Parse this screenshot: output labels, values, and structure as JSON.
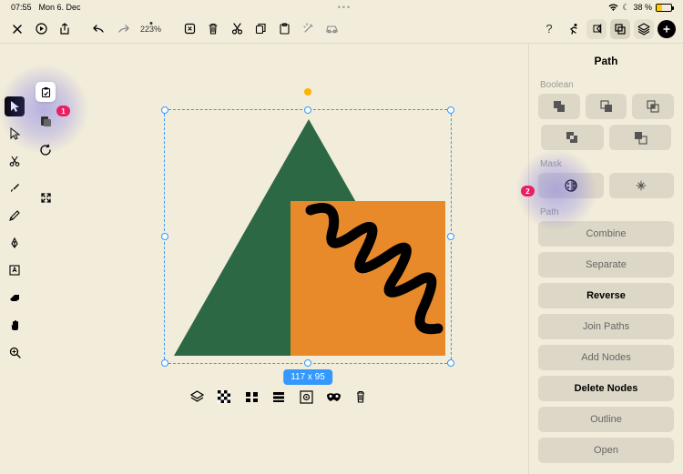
{
  "status": {
    "time": "07:55",
    "date": "Mon 6. Dec",
    "battery_pct": "38 %"
  },
  "toolbar": {
    "zoom": "223%"
  },
  "canvas": {
    "dimensions": "117 x 95"
  },
  "badges": {
    "b1": "1",
    "b2": "2"
  },
  "panel": {
    "title": "Path",
    "sec_boolean": "Boolean",
    "sec_mask": "Mask",
    "sec_path": "Path",
    "buttons": {
      "combine": "Combine",
      "separate": "Separate",
      "reverse": "Reverse",
      "join": "Join Paths",
      "addnodes": "Add Nodes",
      "deletenodes": "Delete Nodes",
      "outline": "Outline",
      "open": "Open"
    }
  }
}
